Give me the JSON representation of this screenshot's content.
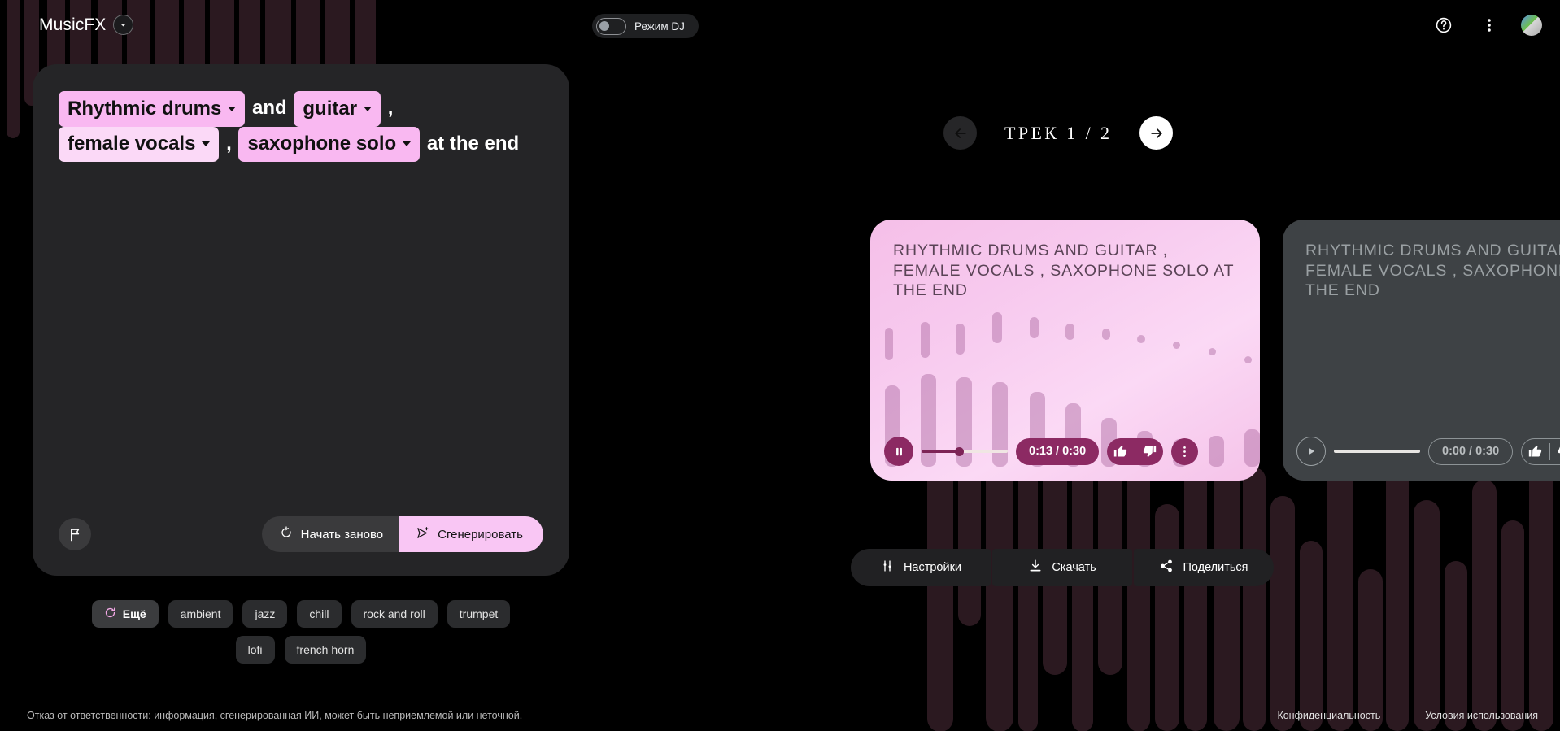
{
  "brand": {
    "name": "MusicFX",
    "caret_icon": "chevron-down-icon"
  },
  "topbar": {
    "dj_mode_label": "Режим DJ",
    "dj_mode_on": false,
    "help_icon": "help-circle-icon",
    "menu_icon": "more-vert-icon",
    "avatar_icon": "avatar"
  },
  "prompt": {
    "tokens": [
      {
        "type": "chip",
        "text": "Rhythmic drums",
        "color": "#f9b8f1"
      },
      {
        "type": "text",
        "text": "and"
      },
      {
        "type": "chip",
        "text": "guitar",
        "color": "#f9b8f1"
      },
      {
        "type": "text",
        "text": ","
      },
      {
        "type": "chip",
        "text": "female vocals",
        "color": "#fbd9f7"
      },
      {
        "type": "text",
        "text": ","
      },
      {
        "type": "chip",
        "text": "saxophone solo",
        "color": "#f9b8f1"
      },
      {
        "type": "text",
        "text": "at the end"
      }
    ],
    "flag_icon": "flag-icon",
    "restart_label": "Начать заново",
    "restart_icon": "restart-icon",
    "generate_label": "Сгенерировать",
    "generate_icon": "send-sparkle-icon"
  },
  "suggestions": {
    "more_label": "Ещё",
    "more_icon": "refresh-icon",
    "items": [
      "ambient",
      "jazz",
      "chill",
      "rock and roll",
      "trumpet",
      "lofi",
      "french horn"
    ]
  },
  "track_nav": {
    "counter": "ТРЕК  1 / 2",
    "prev_icon": "arrow-left-icon",
    "next_icon": "arrow-right-icon",
    "prev_enabled": false,
    "next_enabled": true
  },
  "cards": [
    {
      "title": "RHYTHMIC DRUMS AND GUITAR , FEMALE VOCALS , SAXOPHONE SOLO AT THE END",
      "state": "active",
      "play_icon": "pause-icon",
      "time": "0:13 / 0:30",
      "progress_pct": 43,
      "thumbs_up_icon": "thumb-up-icon",
      "thumbs_down_icon": "thumb-down-icon",
      "kebab_icon": "more-vert-icon"
    },
    {
      "title": "RHYTHMIC DRUMS AND GUITAR , FEMALE VOCALS , SAXOPHONE SOLO AT THE END",
      "state": "idle",
      "play_icon": "play-icon",
      "time": "0:00 / 0:30",
      "progress_pct": 0,
      "thumbs_up_icon": "thumb-up-icon",
      "thumbs_down_icon": "thumb-down-icon",
      "kebab_icon": "more-vert-icon"
    }
  ],
  "actions": [
    {
      "label": "Настройки",
      "icon": "tune-icon"
    },
    {
      "label": "Скачать",
      "icon": "download-icon"
    },
    {
      "label": "Поделиться",
      "icon": "share-icon"
    }
  ],
  "footer": {
    "disclaimer": "Отказ от ответственности: информация, сгенерированная ИИ, может быть неприемлемой или неточной.",
    "privacy": "Конфиденциальность",
    "terms": "Условия использования"
  },
  "colors": {
    "background": "#000000",
    "panel": "#252527",
    "accent_pink": "#f9c6f4",
    "card_pink": "#f5c3e9",
    "card_dark": "#3e4245",
    "player_plum": "#8c2a63",
    "bg_bar": "#2b1920"
  }
}
